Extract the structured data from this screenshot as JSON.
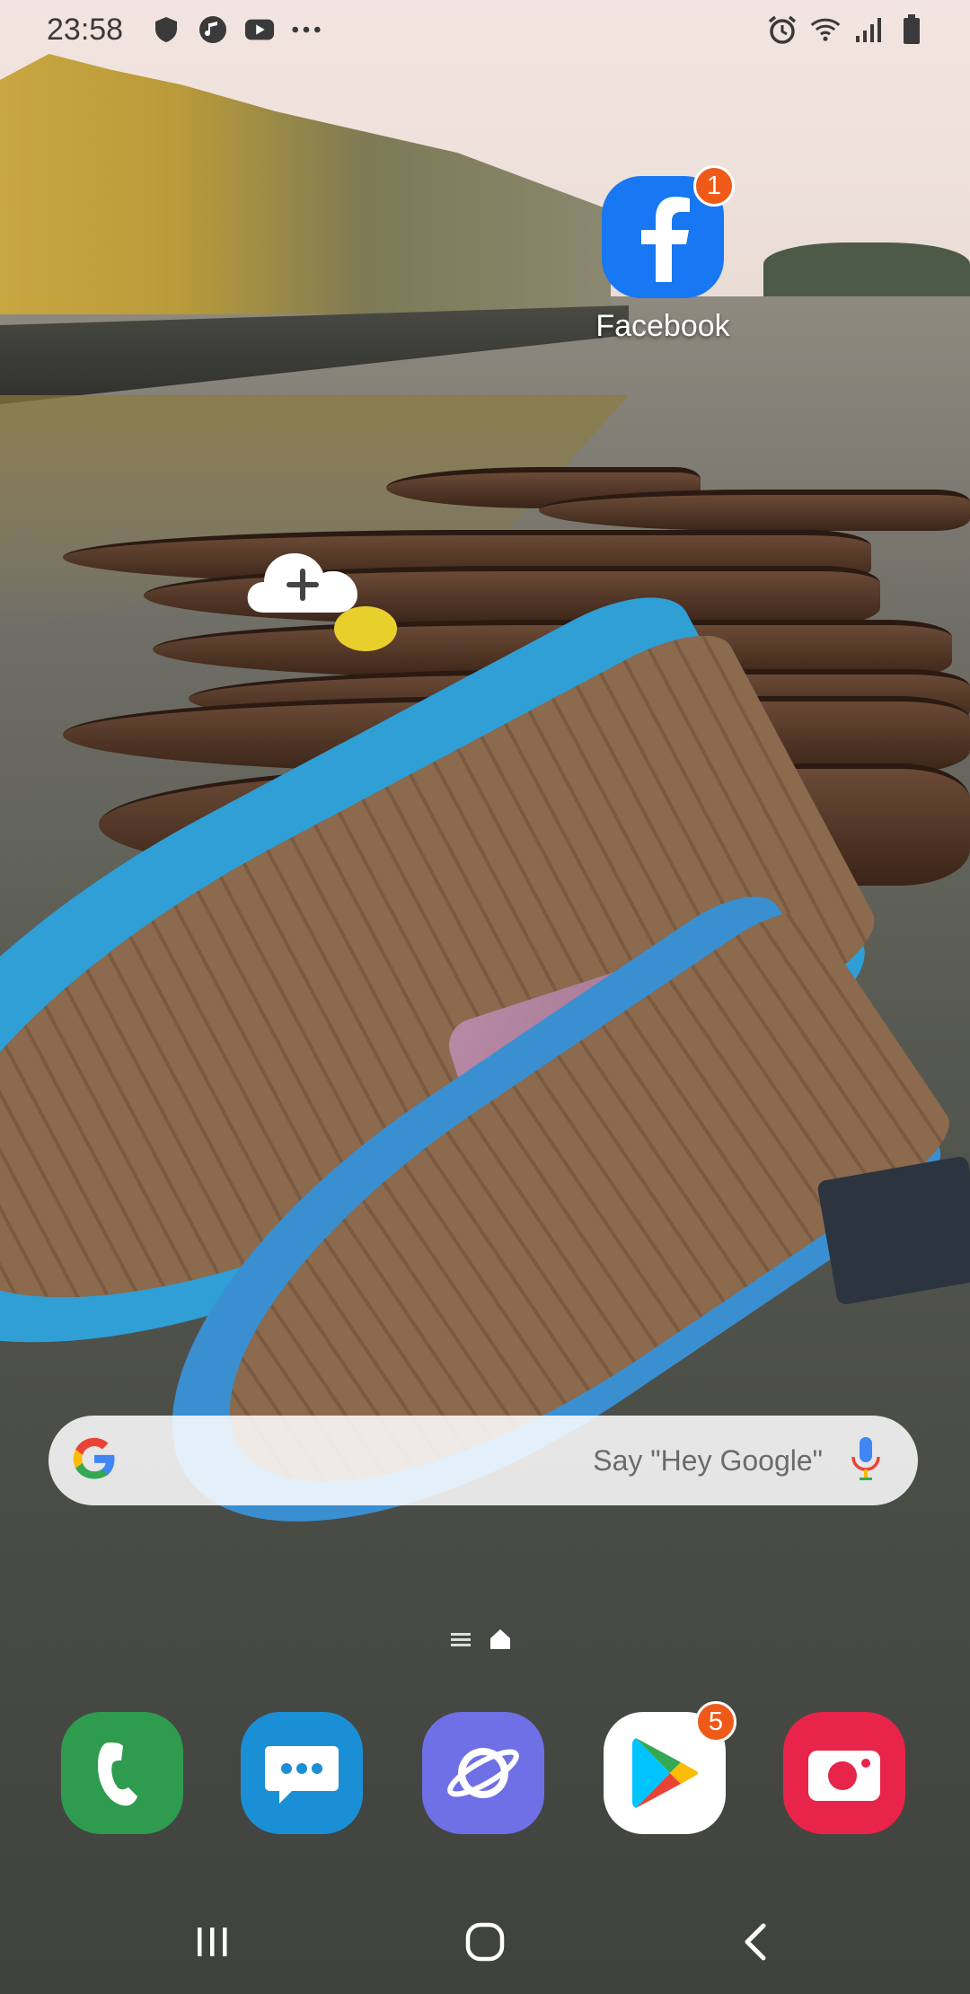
{
  "status_bar": {
    "time": "23:58",
    "left_icons": [
      "shield-icon",
      "music-note-icon",
      "youtube-icon",
      "more-icon"
    ],
    "right_icons": [
      "alarm-icon",
      "wifi-icon",
      "signal-icon",
      "battery-icon"
    ]
  },
  "home": {
    "apps": [
      {
        "name": "facebook",
        "label": "Facebook",
        "badge": "1",
        "color": "#1877f2"
      }
    ]
  },
  "search": {
    "placeholder": "Say \"Hey Google\""
  },
  "dock": [
    {
      "name": "phone",
      "color": "#2e9b4f"
    },
    {
      "name": "messages",
      "color": "#1b8fd6"
    },
    {
      "name": "internet",
      "color": "#6f6fe6"
    },
    {
      "name": "play-store",
      "badge": "5",
      "color": "#ffffff"
    },
    {
      "name": "camera",
      "color": "#e8244a"
    }
  ],
  "nav": [
    "recents",
    "home",
    "back"
  ]
}
